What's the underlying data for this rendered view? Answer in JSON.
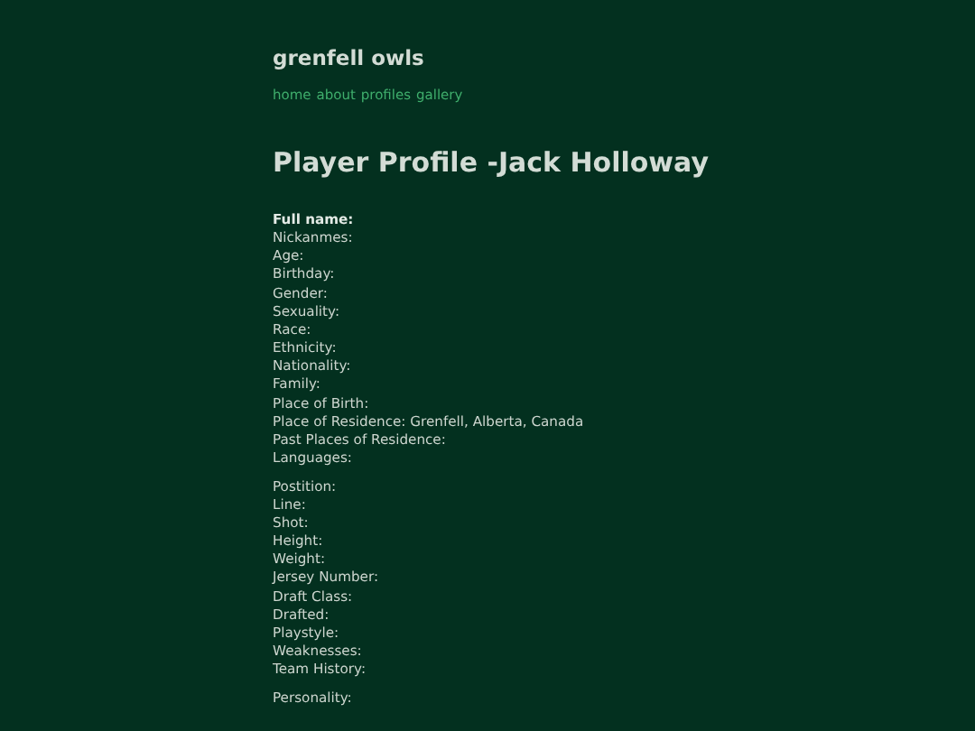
{
  "site_title": "grenfell owls",
  "nav": [
    "home",
    "about",
    "profiles",
    "gallery"
  ],
  "page_title": "Player Profile -Jack Holloway",
  "sections": [
    {
      "lines": [
        {
          "text": "Full name:",
          "bold": true
        },
        {
          "text": "Nickanmes:",
          "bold": false
        },
        {
          "text": "Age:",
          "bold": false
        },
        {
          "text": "Birthday:",
          "bold": false
        },
        {
          "text": "Gender:",
          "bold": false
        },
        {
          "text": "Sexuality:",
          "bold": false
        },
        {
          "text": "Race:",
          "bold": false
        },
        {
          "text": "Ethnicity:",
          "bold": false
        },
        {
          "text": "Nationality:",
          "bold": false
        },
        {
          "text": "Family:",
          "bold": false
        },
        {
          "text": "Place of Birth:",
          "bold": false
        },
        {
          "text": "Place of Residence: Grenfell, Alberta, Canada",
          "bold": false
        },
        {
          "text": "Past Places of Residence:",
          "bold": false
        },
        {
          "text": "Languages:",
          "bold": false
        }
      ]
    },
    {
      "lines": [
        {
          "text": "Postition:",
          "bold": false
        },
        {
          "text": "Line:",
          "bold": false
        },
        {
          "text": "Shot:",
          "bold": false
        },
        {
          "text": "Height:",
          "bold": false
        },
        {
          "text": "Weight:",
          "bold": false
        },
        {
          "text": "Jersey Number:",
          "bold": false
        },
        {
          "text": "Draft Class:",
          "bold": false
        },
        {
          "text": "Drafted:",
          "bold": false
        },
        {
          "text": "Playstyle:",
          "bold": false
        },
        {
          "text": "Weaknesses:",
          "bold": false
        },
        {
          "text": "Team History:",
          "bold": false
        }
      ]
    },
    {
      "lines": [
        {
          "text": "Personality:",
          "bold": false
        }
      ]
    }
  ]
}
